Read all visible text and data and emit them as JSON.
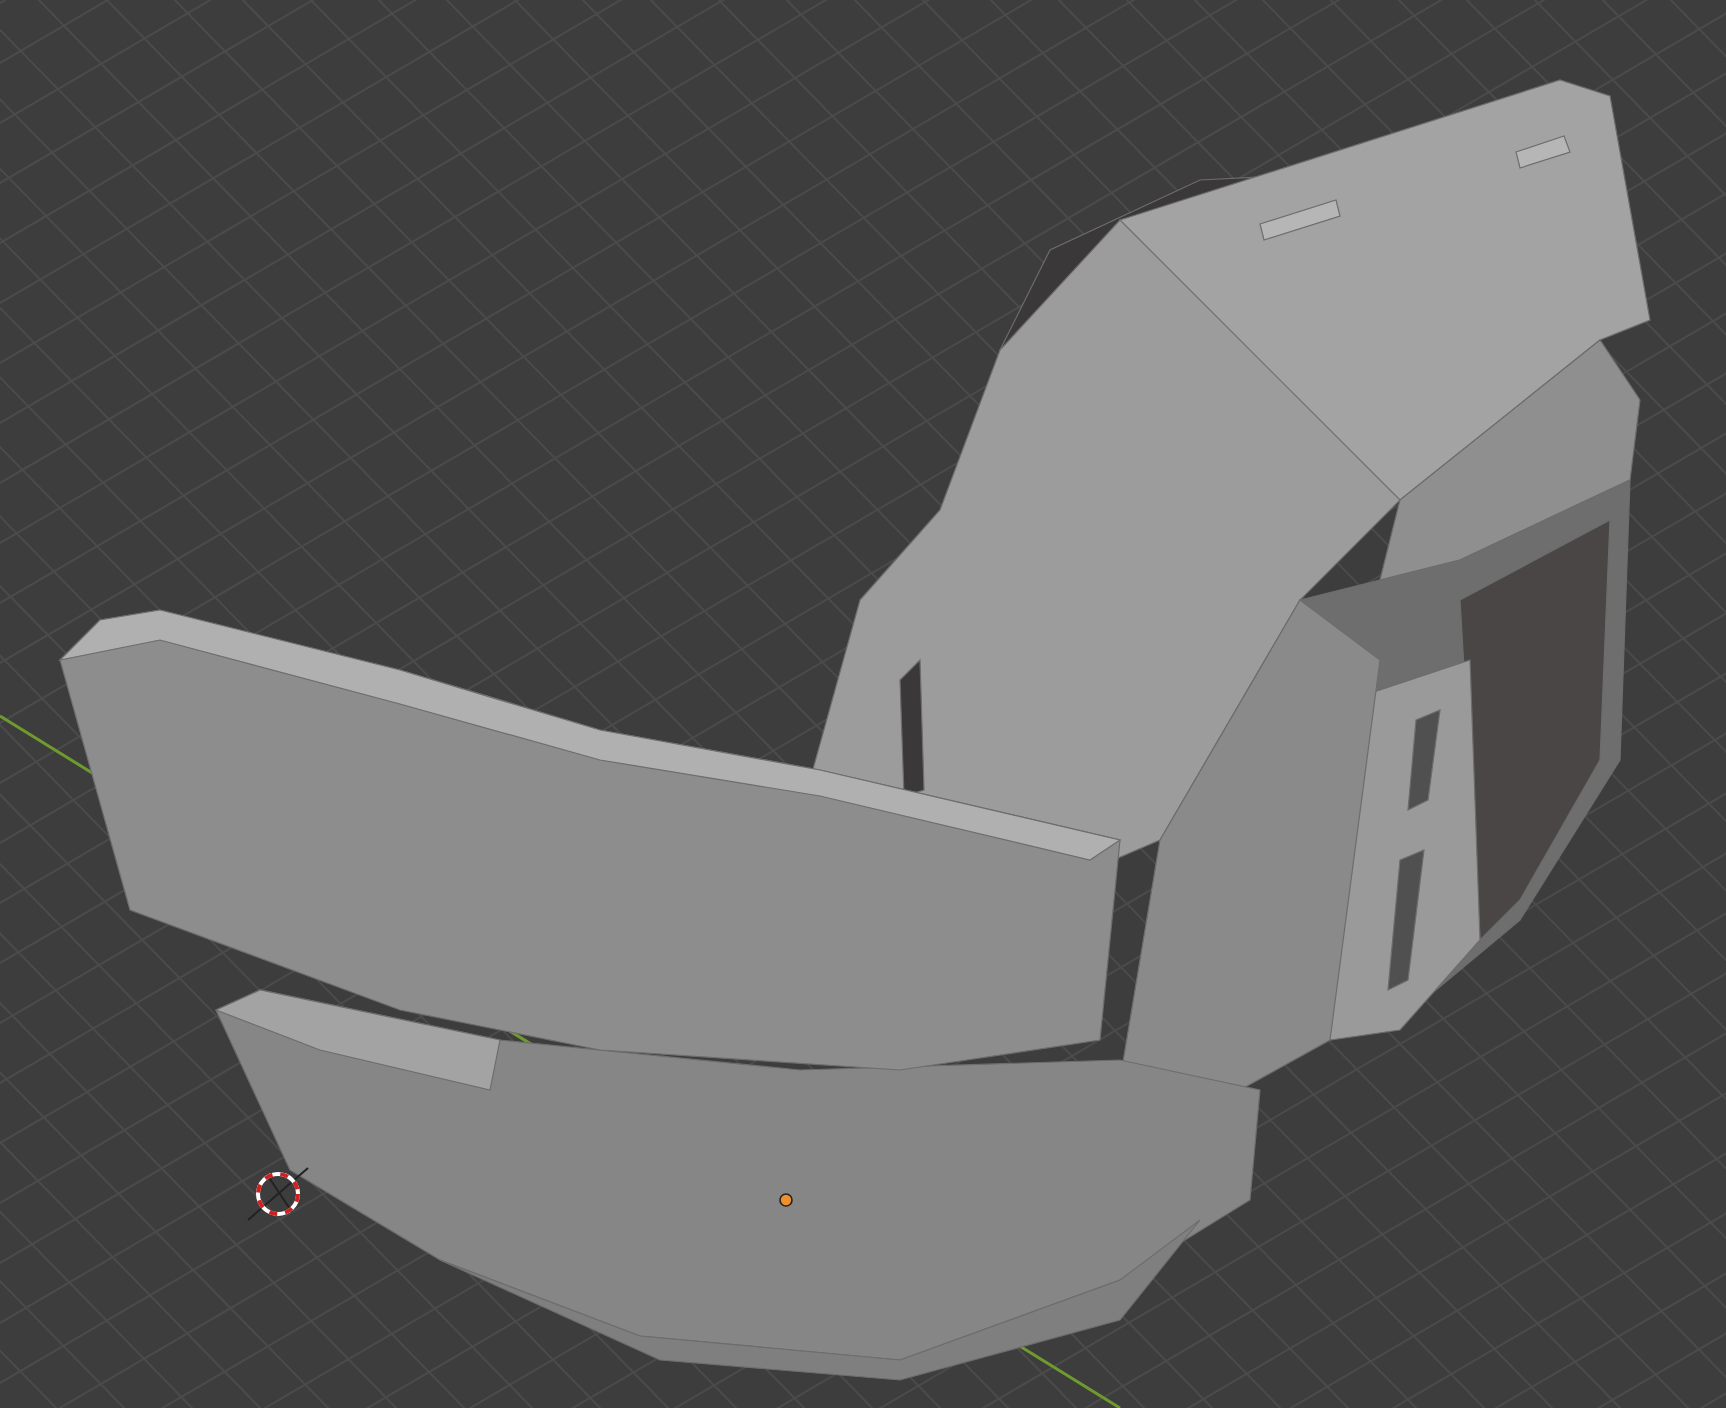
{
  "viewport": {
    "show_grid": true,
    "show_x_axis": true,
    "show_model": true,
    "show_3d_cursor": true,
    "show_origin": true
  }
}
